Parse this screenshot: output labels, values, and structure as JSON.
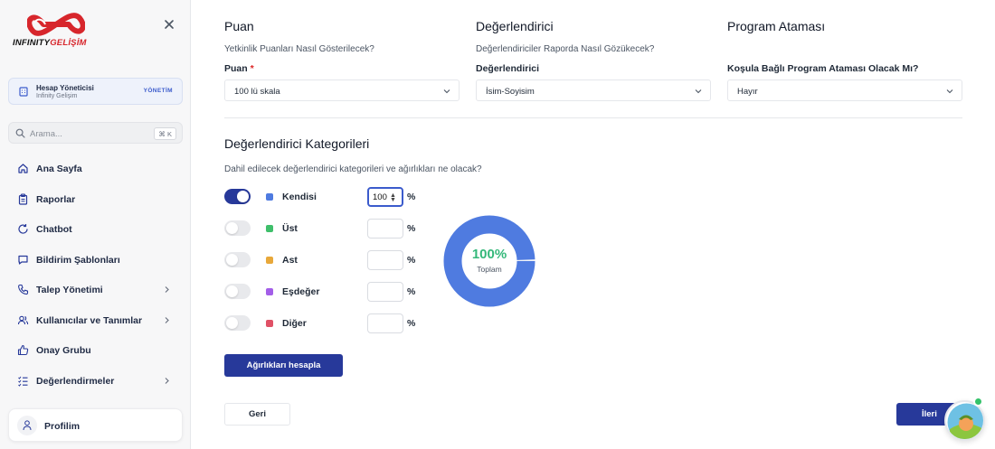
{
  "brand": {
    "name_part1": "INFINITY",
    "name_part2": "GELİŞİM",
    "accent": "#d7262c"
  },
  "account": {
    "title": "Hesap Yöneticisi",
    "subtitle": "Infinity Gelişim",
    "tag": "YÖNETİM"
  },
  "search": {
    "placeholder": "Arama...",
    "shortcut": "⌘ K"
  },
  "nav": {
    "items": [
      {
        "label": "Ana Sayfa",
        "icon": "home-icon"
      },
      {
        "label": "Raporlar",
        "icon": "clipboard-icon"
      },
      {
        "label": "Chatbot",
        "icon": "refresh-icon"
      },
      {
        "label": "Bildirim Şablonları",
        "icon": "message-icon"
      },
      {
        "label": "Talep Yönetimi",
        "icon": "phone-icon",
        "has_children": true
      },
      {
        "label": "Kullanıcılar ve Tanımlar",
        "icon": "users-icon",
        "has_children": true
      },
      {
        "label": "Onay Grubu",
        "icon": "thumbs-up-icon"
      },
      {
        "label": "Değerlendirmeler",
        "icon": "checklist-icon",
        "has_children": true
      }
    ]
  },
  "profile": {
    "label": "Profilim"
  },
  "score": {
    "title": "Puan",
    "description": "Yetkinlik Puanları Nasıl Gösterilecek?",
    "label": "Puan",
    "required_mark": "*",
    "value": "100 lü skala"
  },
  "evaluator": {
    "title": "Değerlendirici",
    "description": "Değerlendiriciler Raporda Nasıl Gözükecek?",
    "label": "Değerlendirici",
    "value": "İsim-Soyisim"
  },
  "program": {
    "title": "Program Ataması",
    "label": "Koşula Bağlı Program Ataması Olacak Mı?",
    "value": "Hayır"
  },
  "categories": {
    "title": "Değerlendirici Kategorileri",
    "description": "Dahil edilecek değerlendirici kategorileri ve ağırlıkları ne olacak?",
    "percent_sign": "%",
    "items": [
      {
        "name": "Kendisi",
        "enabled": true,
        "value": "100",
        "color": "#4f7be0"
      },
      {
        "name": "Üst",
        "enabled": false,
        "value": "",
        "color": "#3fbf6b"
      },
      {
        "name": "Ast",
        "enabled": false,
        "value": "",
        "color": "#e8a83a"
      },
      {
        "name": "Eşdeğer",
        "enabled": false,
        "value": "",
        "color": "#a35ee8"
      },
      {
        "name": "Diğer",
        "enabled": false,
        "value": "",
        "color": "#e05166"
      }
    ]
  },
  "total": {
    "value": "100%",
    "label": "Toplam",
    "fraction": 1.0,
    "color": "#4f7be0",
    "value_color": "#34b87a"
  },
  "buttons": {
    "calculate": "Ağırlıkları hesapla",
    "back": "Geri",
    "next": "İleri"
  },
  "colors": {
    "primary": "#27399a"
  }
}
